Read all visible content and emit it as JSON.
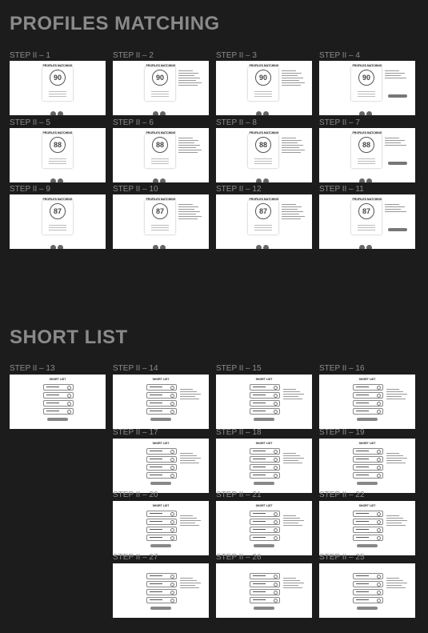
{
  "sections": {
    "profiles_title": "PROFILES MATCHING",
    "shortlist_title": "SHORT LIST"
  },
  "pm_boards": [
    {
      "step": "STEP II – 1",
      "title": "PROFILES MATCHING",
      "score": "90"
    },
    {
      "step": "STEP II – 2",
      "title": "PROFILES MATCHING",
      "score": "90"
    },
    {
      "step": "STEP II – 3",
      "title": "PROFILES MATCHING",
      "score": "90"
    },
    {
      "step": "STEP II – 4",
      "title": "PROFILES MATCHING",
      "score": "90"
    },
    {
      "step": "STEP II – 5",
      "title": "PROFILES MATCHING",
      "score": "88"
    },
    {
      "step": "STEP II – 6",
      "title": "PROFILES MATCHING",
      "score": "88"
    },
    {
      "step": "STEP II – 8",
      "title": "PROFILES MATCHING",
      "score": "88"
    },
    {
      "step": "STEP II – 7",
      "title": "PROFILES MATCHING",
      "score": "88"
    },
    {
      "step": "STEP II – 9",
      "title": "PROFILES MATCHING",
      "score": "87"
    },
    {
      "step": "STEP II – 10",
      "title": "PROFILES MATCHING",
      "score": "87"
    },
    {
      "step": "STEP II – 12",
      "title": "PROFILES MATCHING",
      "score": "87"
    },
    {
      "step": "STEP II – 11",
      "title": "PROFILES MATCHING",
      "score": "87"
    }
  ],
  "sl_boards": [
    {
      "step": "STEP II – 13",
      "title": "SHORT LIST"
    },
    {
      "step": "STEP II – 14",
      "title": "SHORT LIST"
    },
    {
      "step": "STEP II – 15",
      "title": "SHORT LIST"
    },
    {
      "step": "STEP II – 16",
      "title": "SHORT LIST"
    },
    {
      "step": "STEP II – 17",
      "title": "SHORT LIST"
    },
    {
      "step": "STEP II – 18",
      "title": "SHORT LIST"
    },
    {
      "step": "STEP II – 19",
      "title": "SHORT LIST"
    },
    {
      "step": "STEP II – 20",
      "title": "SHORT LIST"
    },
    {
      "step": "STEP II – 21",
      "title": "SHORT LIST"
    },
    {
      "step": "STEP II – 22",
      "title": "SHORT LIST"
    },
    {
      "step": "STEP II – 27",
      "title": ""
    },
    {
      "step": "STEP II – 26",
      "title": ""
    },
    {
      "step": "STEP II – 25",
      "title": ""
    }
  ]
}
